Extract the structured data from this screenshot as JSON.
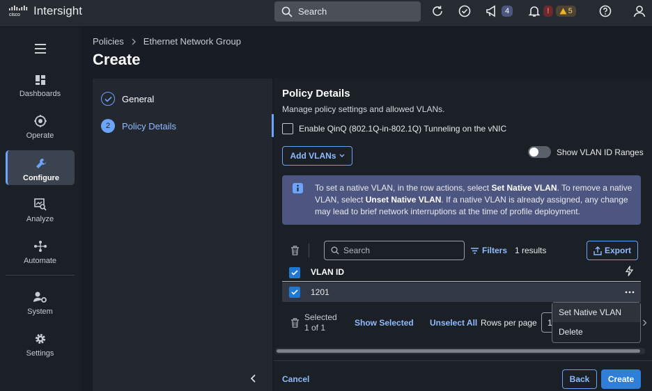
{
  "app": {
    "brand": "cisco",
    "title": "Intersight"
  },
  "topbar": {
    "search_placeholder": "Search",
    "announcements_count": "4",
    "alarms_critical": "!",
    "alarms_warning": "5"
  },
  "sidebar": {
    "items": [
      {
        "label": "Dashboards",
        "icon": "dashboard-icon"
      },
      {
        "label": "Operate",
        "icon": "operate-icon"
      },
      {
        "label": "Configure",
        "icon": "wrench-icon",
        "active": true
      },
      {
        "label": "Analyze",
        "icon": "analyze-icon"
      },
      {
        "label": "Automate",
        "icon": "automate-icon"
      },
      {
        "label": "System",
        "icon": "system-icon"
      },
      {
        "label": "Settings",
        "icon": "gear-icon"
      }
    ]
  },
  "breadcrumb": {
    "items": [
      "Policies",
      "Ethernet Network Group"
    ]
  },
  "page": {
    "title": "Create"
  },
  "steps": [
    {
      "number": "",
      "label": "General",
      "state": "done"
    },
    {
      "number": "2",
      "label": "Policy Details",
      "state": "active"
    }
  ],
  "details": {
    "title": "Policy Details",
    "subtitle": "Manage policy settings and allowed VLANs.",
    "qinq_label": "Enable QinQ (802.1Q-in-802.1Q) Tunneling on the vNIC",
    "add_vlans_label": "Add VLANs",
    "show_ranges_label": "Show VLAN ID Ranges",
    "info": {
      "p1": "To set a native VLAN, in the row actions, select ",
      "b1": "Set Native VLAN",
      "p2": ". To remove a native VLAN, select ",
      "b2": "Unset Native VLAN",
      "p3": ". If a native VLAN is already assigned, any change may lead to brief network interruptions at the time of profile deployment."
    }
  },
  "table": {
    "search_placeholder": "Search",
    "filters_label": "Filters",
    "results": "1 results",
    "export_label": "Export",
    "columns": [
      "VLAN ID"
    ],
    "rows": [
      {
        "vlan_id": "1201"
      }
    ],
    "selected_label": "Selected",
    "selected_count": "1 of 1",
    "show_selected": "Show Selected",
    "unselect_all": "Unselect All",
    "rows_per_page_label": "Rows per page",
    "rows_per_page_value": "1"
  },
  "row_menu": {
    "items": [
      "Set Native VLAN",
      "Delete"
    ]
  },
  "footer": {
    "cancel": "Cancel",
    "back": "Back",
    "create": "Create"
  },
  "colors": {
    "accent": "#6ba4f8",
    "primary_button": "#2f7fd8",
    "info_bg": "#4c5680",
    "warning": "#f0b323",
    "critical": "#d32f2f"
  }
}
